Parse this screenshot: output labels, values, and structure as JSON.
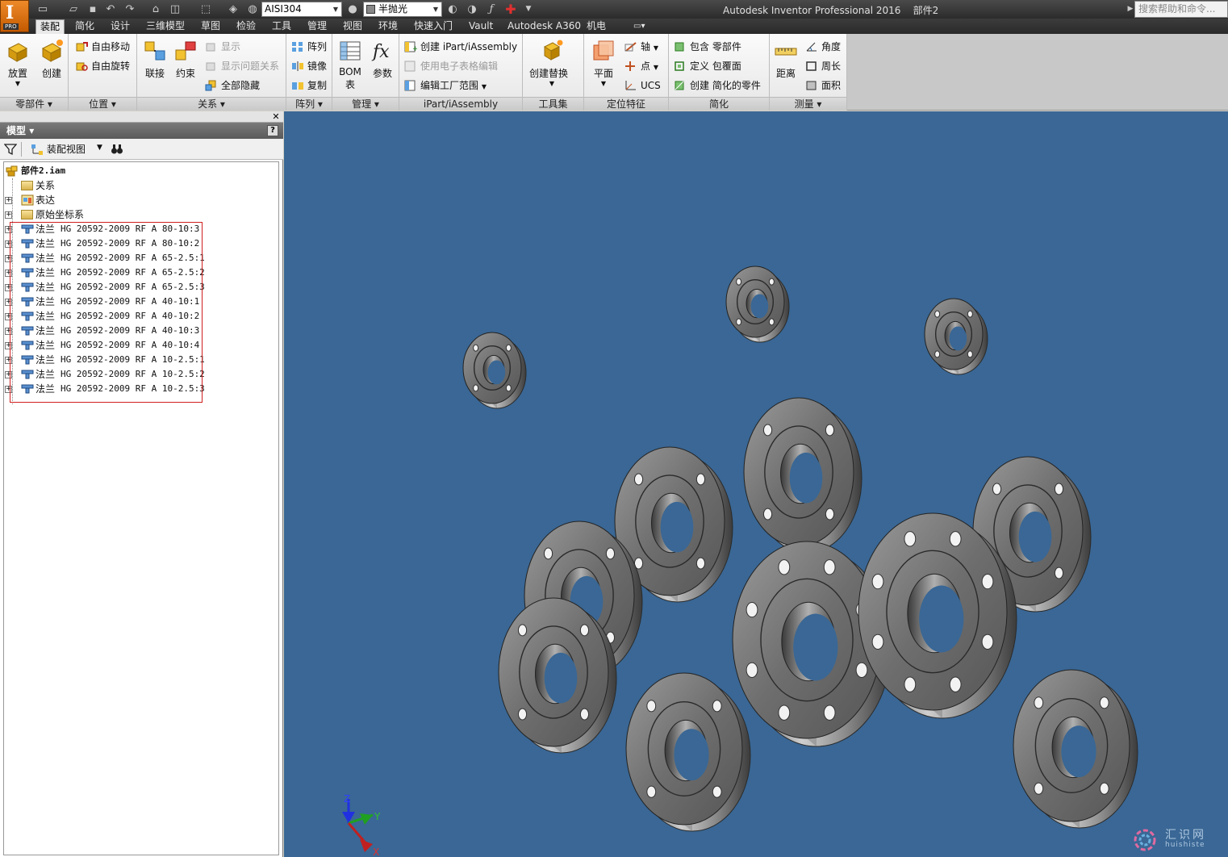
{
  "titlebar": {
    "logo_letter": "I",
    "logo_badge": "PRO",
    "material": "AISI304",
    "appearance": "半抛光",
    "app_title": "Autodesk Inventor Professional 2016",
    "doc_name": "部件2",
    "help_placeholder": "搜索帮助和命令..."
  },
  "tabs": [
    "装配",
    "简化",
    "设计",
    "三维模型",
    "草图",
    "检验",
    "工具",
    "管理",
    "视图",
    "环境",
    "快速入门",
    "Vault",
    "Autodesk A360",
    "机电"
  ],
  "active_tab": "装配",
  "ribbon": {
    "component": {
      "title": "零部件",
      "place": "放置",
      "create": "创建"
    },
    "position": {
      "title": "位置",
      "free_move": "自由移动",
      "free_rotate": "自由旋转"
    },
    "relationships": {
      "title": "关系",
      "joint": "联接",
      "constrain": "约束",
      "show": "显示",
      "show_sick": "显示问题关系",
      "hide_all": "全部隐藏"
    },
    "pattern": {
      "title": "阵列",
      "pattern": "阵列",
      "mirror": "镜像",
      "copy": "复制"
    },
    "manage": {
      "title": "管理",
      "bom": "BOM",
      "bom2": "表",
      "params": "参数"
    },
    "ipart": {
      "title": "iPart/iAssembly",
      "create": "创建 iPart/iAssembly",
      "spreadsheet": "使用电子表格编辑",
      "factory": "编辑工厂范围"
    },
    "productivity": {
      "title": "工具集",
      "substitute": "创建替换"
    },
    "work_features": {
      "title": "定位特征",
      "plane": "平面",
      "axis": "轴",
      "point": "点",
      "ucs": "UCS"
    },
    "simplification": {
      "title": "简化",
      "include": "包含 零部件",
      "envelope": "定义 包覆面",
      "simplified": "创建 简化的零件"
    },
    "measure": {
      "title": "测量",
      "distance": "距离",
      "angle": "角度",
      "perimeter": "周长",
      "area": "面积"
    }
  },
  "browser": {
    "header": "模型",
    "view_label": "装配视图",
    "root": "部件2.iam",
    "folders": [
      "关系",
      "表达",
      "原始坐标系"
    ],
    "parts": [
      {
        "name": "法兰",
        "spec": "HG 20592-2009 RF A 80-10:3"
      },
      {
        "name": "法兰",
        "spec": "HG 20592-2009 RF A 80-10:2"
      },
      {
        "name": "法兰",
        "spec": "HG 20592-2009 RF A 65-2.5:1"
      },
      {
        "name": "法兰",
        "spec": "HG 20592-2009 RF A 65-2.5:2"
      },
      {
        "name": "法兰",
        "spec": "HG 20592-2009 RF A 65-2.5:3"
      },
      {
        "name": "法兰",
        "spec": "HG 20592-2009 RF A 40-10:1"
      },
      {
        "name": "法兰",
        "spec": "HG 20592-2009 RF A 40-10:2"
      },
      {
        "name": "法兰",
        "spec": "HG 20592-2009 RF A 40-10:3"
      },
      {
        "name": "法兰",
        "spec": "HG 20592-2009 RF A 40-10:4"
      },
      {
        "name": "法兰",
        "spec": "HG 20592-2009 RF A 10-2.5:1"
      },
      {
        "name": "法兰",
        "spec": "HG 20592-2009 RF A 10-2.5:2"
      },
      {
        "name": "法兰",
        "spec": "HG 20592-2009 RF A 10-2.5:3"
      }
    ]
  },
  "triad": {
    "x": "X",
    "y": "Y",
    "z": "Z"
  },
  "watermark": {
    "text": "汇识网",
    "sub": "huishiste"
  },
  "colors": {
    "viewport_bg": "#3a6795",
    "flange": "#7d7d7d",
    "accent": "#e87d1e"
  }
}
